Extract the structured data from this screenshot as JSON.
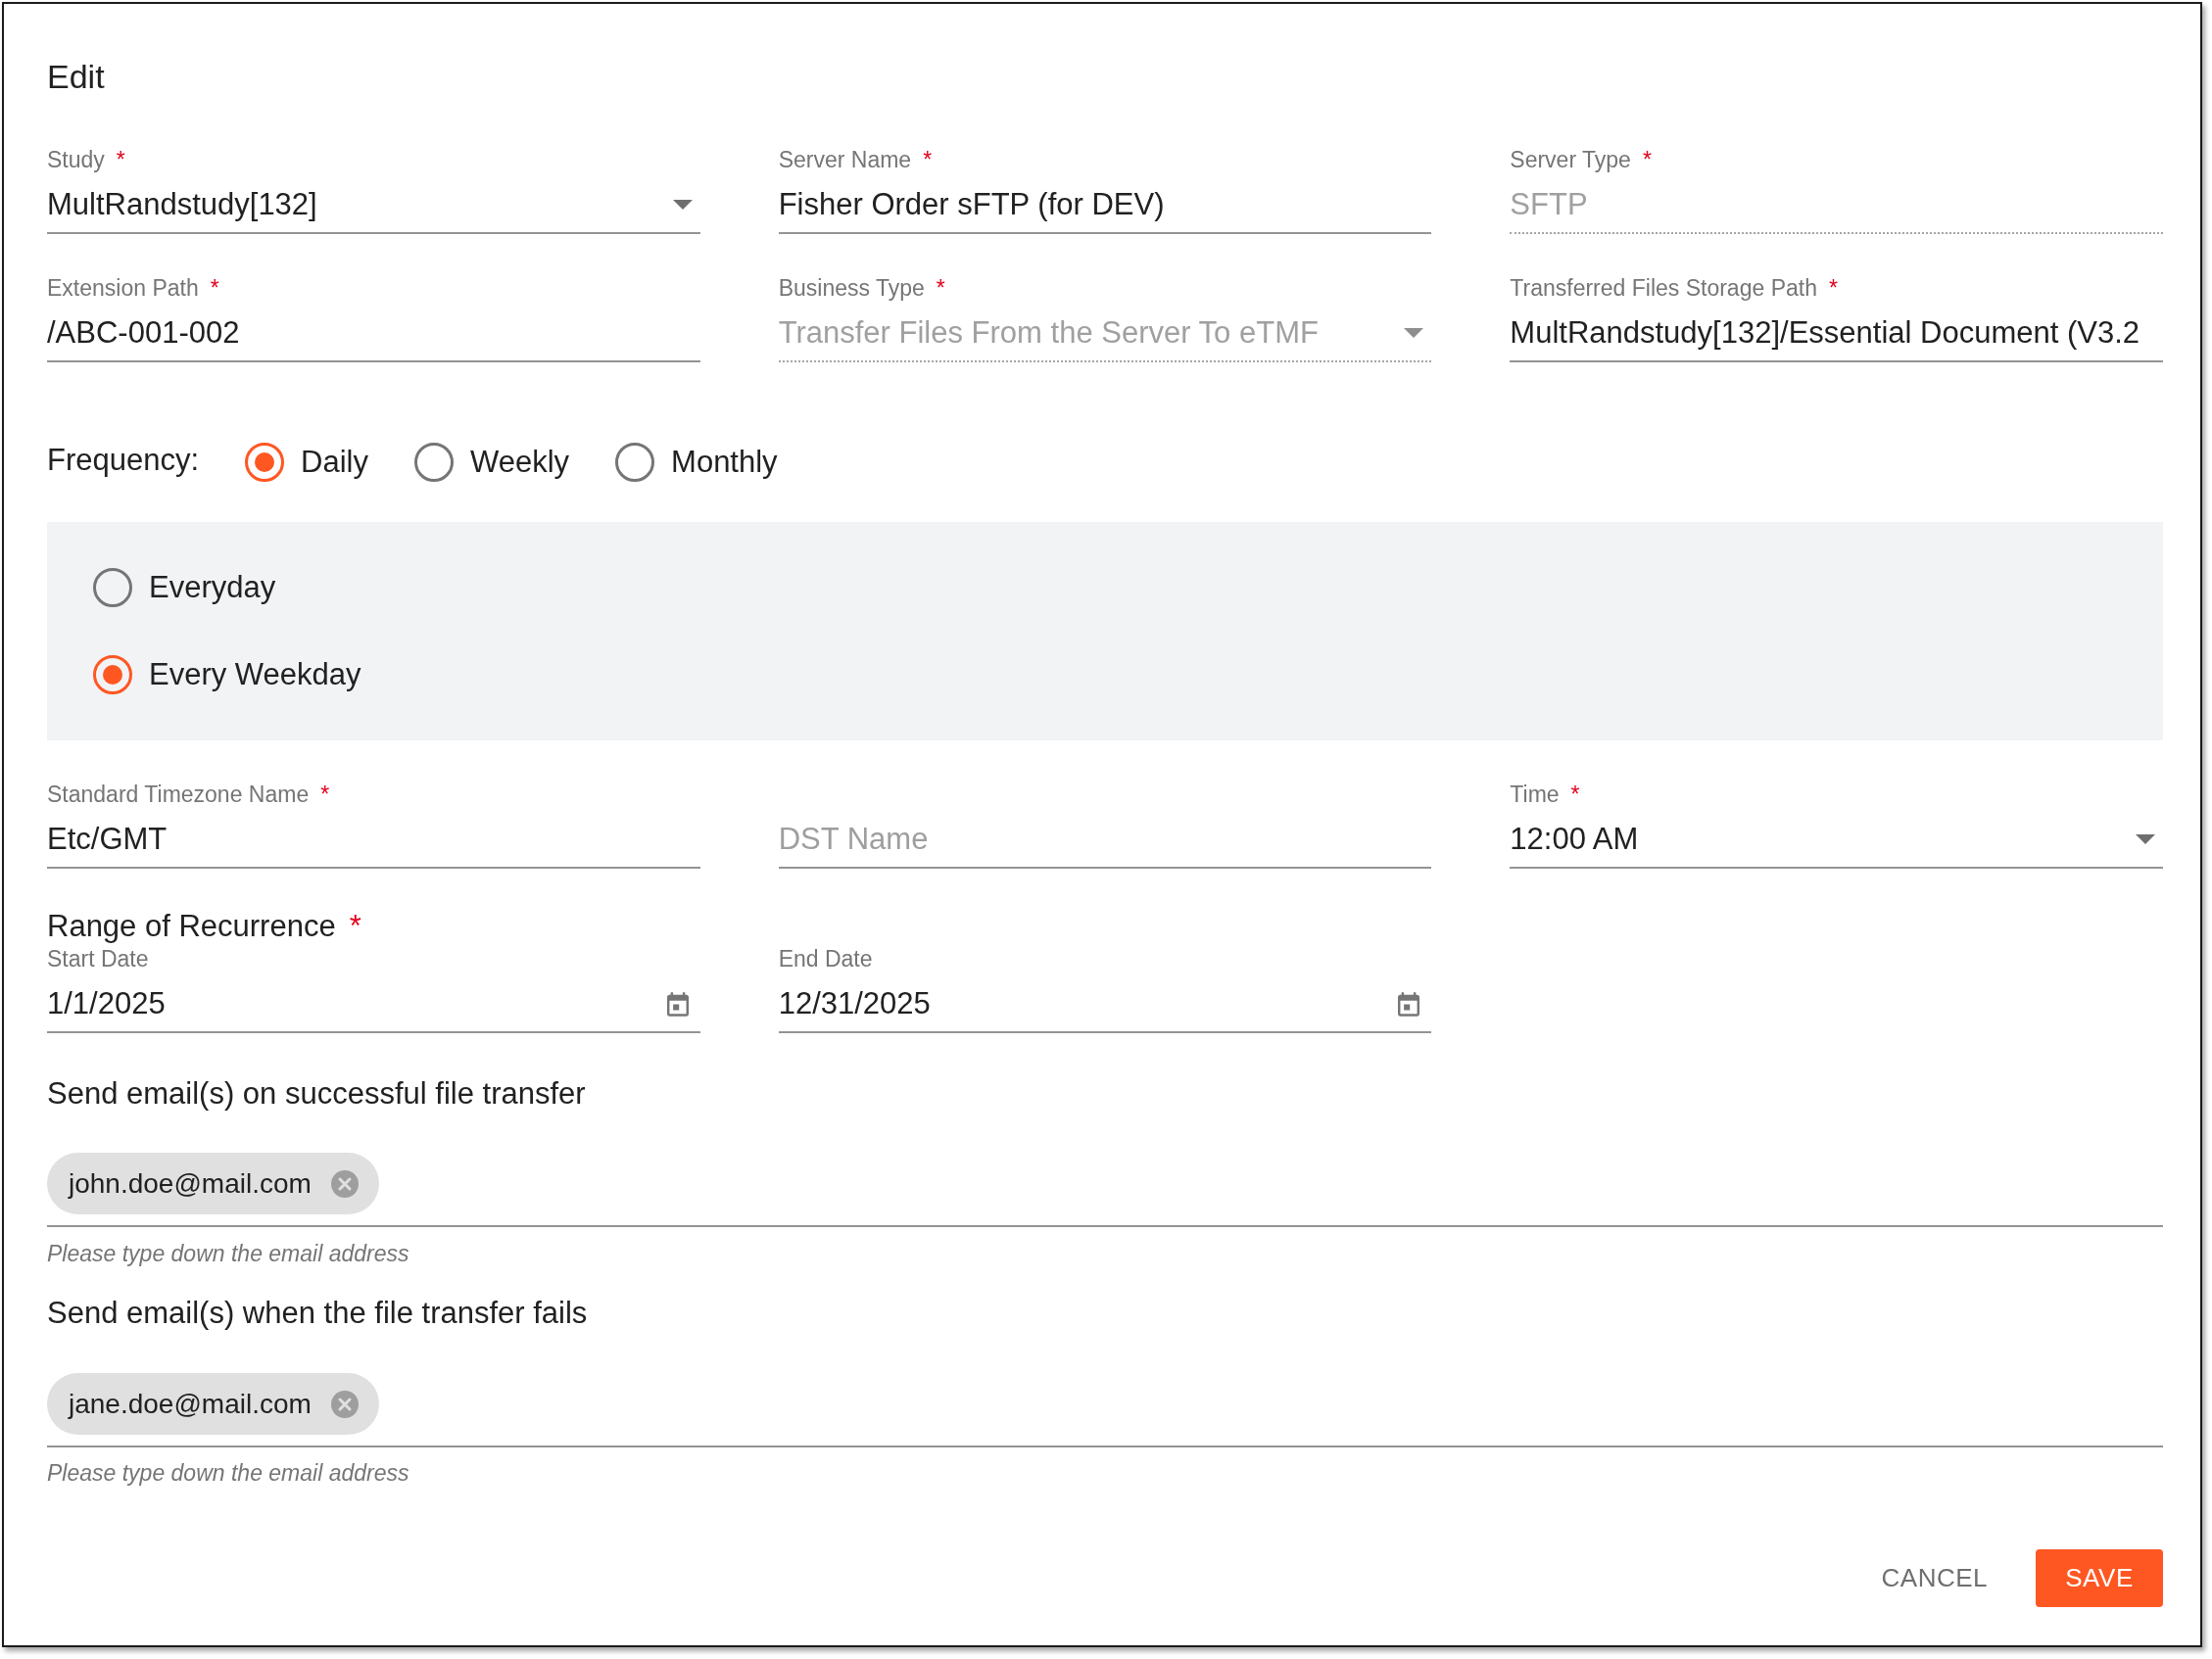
{
  "dialog": {
    "title": "Edit"
  },
  "fields": [
    {
      "label": "Study",
      "required_mark": "*",
      "kind": "select",
      "value": "MultRandstudy[132]",
      "disabled": false
    },
    {
      "label": "Server Name",
      "required_mark": "*",
      "kind": "text",
      "value": "Fisher Order sFTP (for DEV)",
      "disabled": false
    },
    {
      "label": "Server Type",
      "required_mark": "*",
      "kind": "text",
      "value": "SFTP",
      "disabled": true
    },
    {
      "label": "Extension Path",
      "required_mark": "*",
      "kind": "text",
      "value": "/ABC-001-002",
      "disabled": false
    },
    {
      "label": "Business Type",
      "required_mark": "*",
      "kind": "select",
      "value": "Transfer Files From the Server To eTMF",
      "disabled": true
    },
    {
      "label": "Transferred Files Storage Path",
      "required_mark": "*",
      "kind": "text",
      "value": "MultRandstudy[132]/Essential Document (V3.2",
      "disabled": false
    }
  ],
  "frequency": {
    "label": "Frequency:",
    "options": [
      {
        "label": "Daily",
        "selected": true
      },
      {
        "label": "Weekly",
        "selected": false
      },
      {
        "label": "Monthly",
        "selected": false
      }
    ]
  },
  "daily_options": [
    {
      "label": "Everyday",
      "selected": false
    },
    {
      "label": "Every Weekday",
      "selected": true
    }
  ],
  "schedule_fields": [
    {
      "label": "Standard Timezone Name",
      "required_mark": "*",
      "kind": "text",
      "value": "Etc/GMT",
      "disabled": false
    },
    {
      "kind": "text",
      "placeholder": "DST Name",
      "disabled": false
    },
    {
      "label": "Time",
      "required_mark": "*",
      "kind": "select",
      "value": "12:00 AM",
      "disabled": false
    }
  ],
  "recurrence": {
    "title": "Range of Recurrence",
    "required_mark": "*",
    "fields": [
      {
        "label": "Start Date",
        "kind": "date",
        "value": "1/1/2025"
      },
      {
        "label": "End Date",
        "kind": "date",
        "value": "12/31/2025"
      }
    ]
  },
  "email_groups": [
    {
      "title": "Send email(s) on successful file transfer",
      "chips": [
        "john.doe@mail.com"
      ],
      "helper": "Please type down the email address"
    },
    {
      "title": "Send email(s) when the file transfer fails",
      "chips": [
        "jane.doe@mail.com"
      ],
      "helper": "Please type down the email address"
    }
  ],
  "actions": [
    {
      "label": "CANCEL",
      "kind": "text"
    },
    {
      "label": "SAVE",
      "kind": "primary"
    }
  ]
}
